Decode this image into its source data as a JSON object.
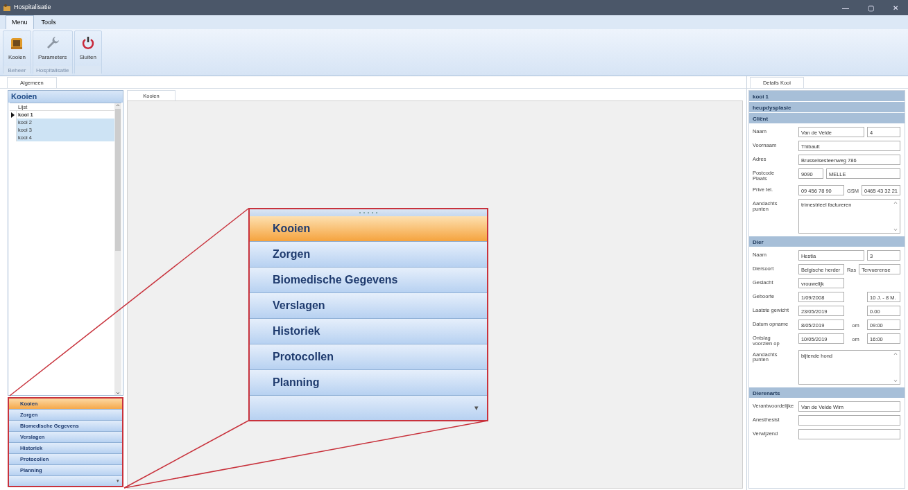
{
  "window": {
    "title": "Hospitalisatie",
    "controls": [
      "—",
      "▢",
      "✕"
    ]
  },
  "ribbon": {
    "tabs": [
      {
        "label": "Menu",
        "selected": true
      },
      {
        "label": "Tools",
        "selected": false
      }
    ],
    "groups": [
      {
        "label": "Beheer",
        "buttons": [
          {
            "label": "Kooien"
          }
        ]
      },
      {
        "label": "Hospitalisatie",
        "buttons": [
          {
            "label": "Parameters"
          }
        ]
      },
      {
        "buttons": [
          {
            "label": "Sluiten"
          }
        ]
      }
    ]
  },
  "main_tabs": [
    {
      "label": "Algemeen",
      "selected": true
    }
  ],
  "left_panel": {
    "title": "Kooien",
    "list": {
      "column": "Lijst",
      "rows": [
        {
          "label": "kooi 1",
          "current": true,
          "selected": false
        },
        {
          "label": "kooi 2",
          "current": false,
          "selected": true
        },
        {
          "label": "kooi 3",
          "current": false,
          "selected": true
        },
        {
          "label": "kooi 4",
          "current": false,
          "selected": true
        }
      ]
    }
  },
  "nav_bar": {
    "items": [
      {
        "label": "Kooien",
        "selected": true
      },
      {
        "label": "Zorgen",
        "selected": false
      },
      {
        "label": "Biomedische Gegevens",
        "selected": false
      },
      {
        "label": "Verslagen",
        "selected": false
      },
      {
        "label": "Historiek",
        "selected": false
      },
      {
        "label": "Protocollen",
        "selected": false
      },
      {
        "label": "Planning",
        "selected": false
      }
    ],
    "more": "▾"
  },
  "center": {
    "tabs": [
      {
        "label": "Kooien",
        "selected": true
      }
    ]
  },
  "zoom_callout": {
    "items": [
      {
        "label": "Kooien",
        "selected": true
      },
      {
        "label": "Zorgen",
        "selected": false
      },
      {
        "label": "Biomedische Gegevens",
        "selected": false
      },
      {
        "label": "Verslagen",
        "selected": false
      },
      {
        "label": "Historiek",
        "selected": false
      },
      {
        "label": "Protocollen",
        "selected": false
      },
      {
        "label": "Planning",
        "selected": false
      }
    ],
    "more": "▾"
  },
  "details": {
    "tab": {
      "label": "Details Kooi",
      "selected": true
    },
    "headers": [
      "kooi 1",
      "heupdysplasie"
    ],
    "sections": [
      {
        "title": "Cliënt",
        "rows": [
          {
            "label": "Naam",
            "items": [
              {
                "kind": "field",
                "value": "Van de Velde"
              },
              {
                "kind": "tiny_field",
                "value": "4"
              }
            ]
          },
          {
            "label": "Voornaam",
            "items": [
              {
                "kind": "field",
                "value": "Thibault"
              }
            ]
          },
          {
            "label": "Adres",
            "items": [
              {
                "kind": "field",
                "value": "Brusselsesteenweg 786"
              }
            ]
          },
          {
            "label": "Postcode\nPlaats",
            "items": [
              {
                "kind": "short_field",
                "value": "9090"
              },
              {
                "kind": "field",
                "value": "MELLE"
              }
            ]
          },
          {
            "label": "Prive tel.",
            "items": [
              {
                "kind": "fixed_field",
                "value": "09 456 78 90"
              },
              {
                "kind": "label",
                "value": "GSM"
              },
              {
                "kind": "field",
                "value": "0465 43 32 21"
              }
            ]
          },
          {
            "label": "Aandachts\npunten",
            "items": [
              {
                "kind": "textarea",
                "value": "trimestrieel factureren"
              }
            ]
          }
        ]
      },
      {
        "title": "Dier",
        "rows": [
          {
            "label": "Naam",
            "items": [
              {
                "kind": "field",
                "value": "Hestia"
              },
              {
                "kind": "tiny_field",
                "value": "3"
              }
            ]
          },
          {
            "label": "Diersoort",
            "items": [
              {
                "kind": "fixed_field",
                "value": "Belgische herder"
              },
              {
                "kind": "label",
                "value": "Ras"
              },
              {
                "kind": "field",
                "value": "Tervuerense"
              }
            ]
          },
          {
            "label": "Geslacht",
            "items": [
              {
                "kind": "fixed_field",
                "value": "vrouwelijk"
              }
            ]
          },
          {
            "label": "Geboorte",
            "items": [
              {
                "kind": "fixed_field",
                "value": "1/09/2008"
              },
              {
                "kind": "tiny_field",
                "value": "10 J. - 8 M."
              }
            ]
          },
          {
            "label": "Laatste gewicht",
            "items": [
              {
                "kind": "fixed_field",
                "value": "23/05/2019"
              },
              {
                "kind": "tiny_field",
                "value": "0.00"
              }
            ]
          },
          {
            "label": "Datum opname",
            "items": [
              {
                "kind": "fixed_field",
                "value": "8/05/2019"
              },
              {
                "kind": "label",
                "value": "om"
              },
              {
                "kind": "tiny_field",
                "value": "09:00"
              }
            ]
          },
          {
            "label": "Ontslag\nvoorzien op",
            "items": [
              {
                "kind": "fixed_field",
                "value": "10/05/2019"
              },
              {
                "kind": "label",
                "value": "om"
              },
              {
                "kind": "tiny_field",
                "value": "16:00"
              }
            ]
          },
          {
            "label": "Aandachts\npunten",
            "items": [
              {
                "kind": "textarea",
                "value": "bijtende hond"
              }
            ]
          }
        ]
      },
      {
        "title": "Dierenarts",
        "rows": [
          {
            "label": "Verantwoordelijke",
            "items": [
              {
                "kind": "field",
                "value": "Van de Velde Wim"
              }
            ]
          },
          {
            "label": "Anesthesist",
            "items": [
              {
                "kind": "field"
              }
            ]
          },
          {
            "label": "Verwijzend",
            "items": [
              {
                "kind": "field"
              }
            ]
          }
        ]
      }
    ]
  }
}
